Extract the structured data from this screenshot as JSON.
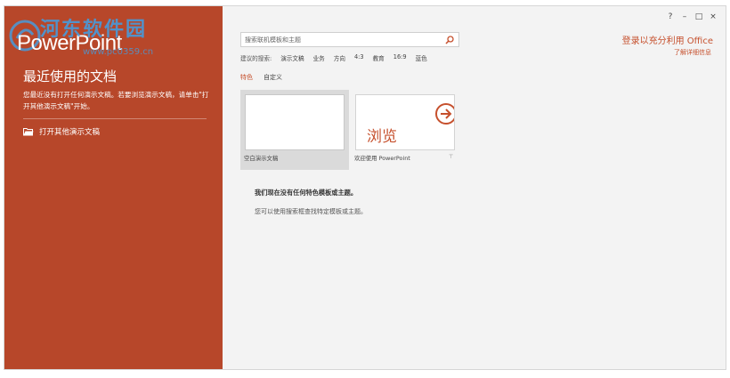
{
  "watermark": {
    "text": "河东软件园",
    "url": "www.pc0359.cn"
  },
  "left": {
    "app_name": "PowerPoint",
    "recent_title": "最近使用的文档",
    "recent_desc": "您最近没有打开任何演示文稿。若要浏览演示文稿，请单击\"打开其他演示文稿\"开始。",
    "open_other_label": "打开其他演示文稿",
    "icon": "folder-open-icon"
  },
  "window_controls": {
    "help": "?",
    "minimize": "–",
    "restore": "□",
    "close": "×"
  },
  "account": {
    "signin_label": "登录以充分利用 Office",
    "learn_more": "了解详细信息"
  },
  "search": {
    "placeholder": "搜索联机模板和主题",
    "icon": "search-icon"
  },
  "suggested": {
    "label": "建议的搜索:",
    "items": [
      "演示文稿",
      "业务",
      "方向",
      "4:3",
      "教育",
      "16:9",
      "蓝色"
    ]
  },
  "tabs": [
    {
      "label": "特色",
      "active": true
    },
    {
      "label": "自定义",
      "active": false
    }
  ],
  "templates": [
    {
      "caption": "空白演示文稿"
    },
    {
      "caption": "欢迎使用 PowerPoint",
      "thumb_word": "浏览",
      "pin": "⊤"
    }
  ],
  "notice": {
    "title": "我们现在没有任何特色模板或主题。",
    "sub": "您可以使用搜索框查找特定模板或主题。"
  },
  "colors": {
    "accent": "#b7472a",
    "link": "#c6502d",
    "background": "#f3f3f3"
  }
}
